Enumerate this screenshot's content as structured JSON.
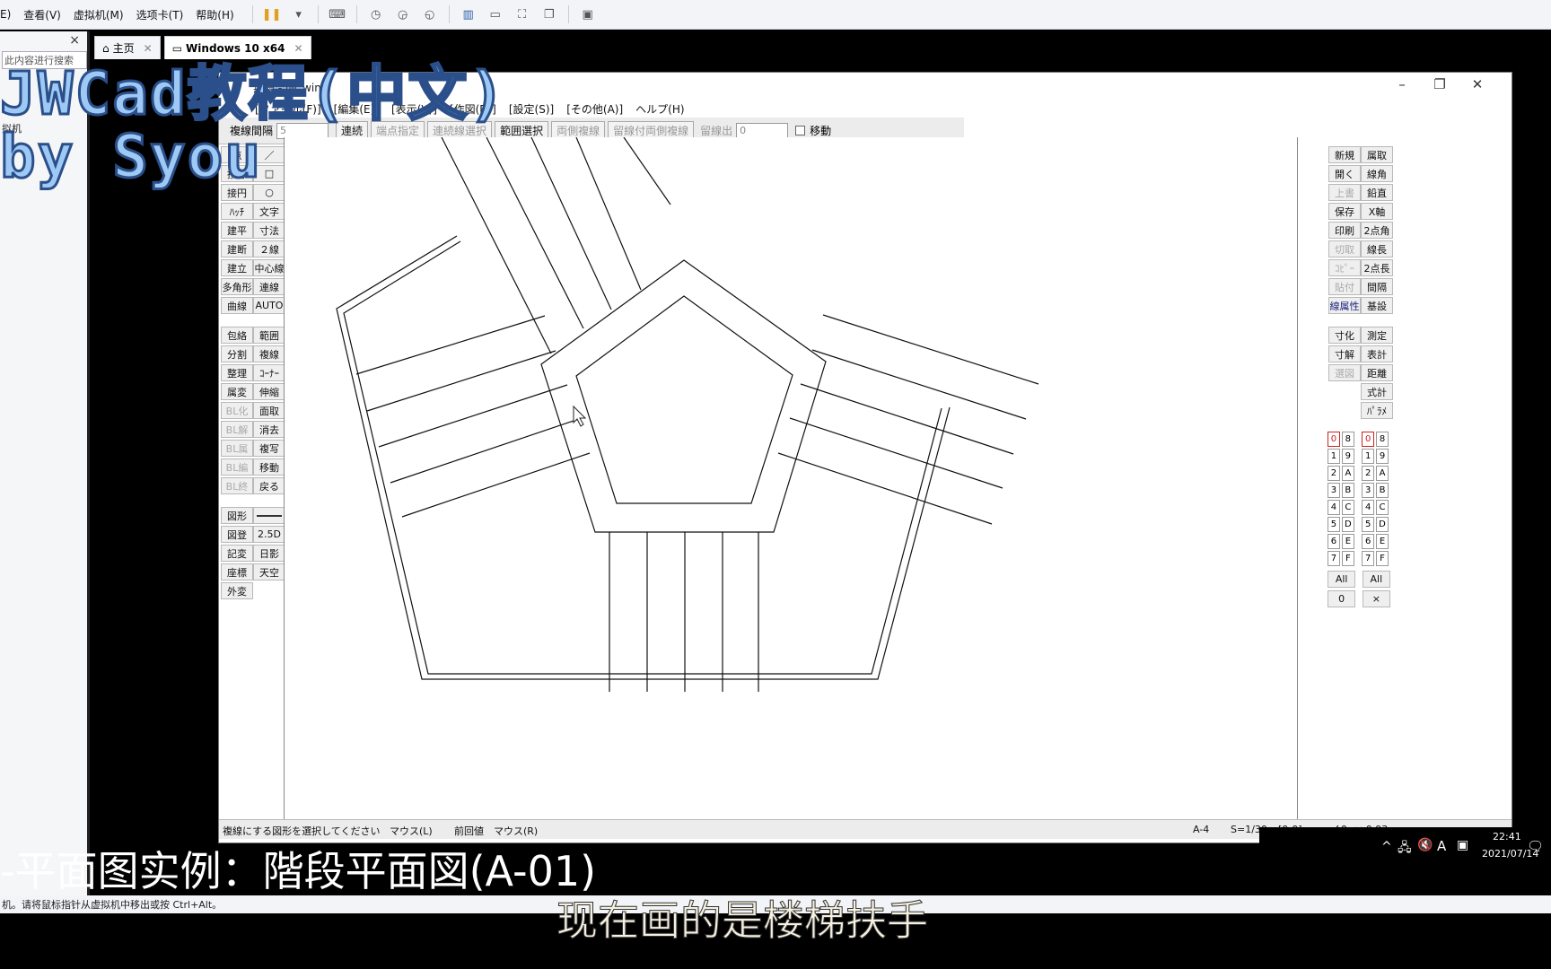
{
  "host": {
    "menus": [
      "E)",
      "查看(V)",
      "虚拟机(M)",
      "选项卡(T)",
      "帮助(H)"
    ],
    "tabs": [
      {
        "label": "主页"
      },
      {
        "label": "Windows 10 x64"
      }
    ],
    "library_close": "×",
    "library_search": "此内容进行搜索",
    "library_item": "拟机",
    "status": "机。请将鼠标指针从虚拟机中移出或按 Ctrl+Alt。"
  },
  "jw": {
    "title": "無題 - jw_win",
    "menus": [
      "[ファイル(F)]",
      "[編集(E)]",
      "[表示(V)]",
      "[作図(D)]",
      "[設定(S)]",
      "[その他(A)]",
      "ヘルプ(H)"
    ],
    "ctrlbar": {
      "label": "複線間隔",
      "value": "5",
      "buttons": [
        "連続",
        "端点指定",
        "連続線選択",
        "範囲選択",
        "両側複線",
        "留線付両側複線",
        "留線出"
      ],
      "dim_buttons": [
        "端点指定",
        "連続線選択",
        "両側複線",
        "留線付両側複線",
        "留線出"
      ],
      "extra_value": "0",
      "move_label": "移動"
    },
    "left_col1": [
      "点",
      "接線",
      "接円",
      "ﾊｯﾁ",
      "建平",
      "建断",
      "建立",
      "多角形",
      "曲線",
      "包絡",
      "分割",
      "整理",
      "属変",
      "BL化",
      "BL解",
      "BL属",
      "BL編",
      "BL終",
      "図形",
      "図登",
      "記変",
      "座標",
      "外変"
    ],
    "left_col2": [
      "／",
      "□",
      "○",
      "文字",
      "寸法",
      "２線",
      "中心線",
      "連線",
      "AUTO",
      "範囲",
      "複線",
      "ｺｰﾅｰ",
      "伸縮",
      "面取",
      "消去",
      "複写",
      "移動",
      "戻る",
      "",
      "2.5D",
      "日影",
      "天空"
    ],
    "right_col1": [
      "新規",
      "開く",
      "上書",
      "保存",
      "印刷",
      "切取",
      "ｺﾋﾟｰ",
      "貼付",
      "線属性",
      "寸化",
      "寸解",
      "選図",
      "",
      "All",
      "0"
    ],
    "right_col2": [
      "属取",
      "線角",
      "鉛直",
      "X軸",
      "2点角",
      "線長",
      "2点長",
      "間隔",
      "基設",
      "測定",
      "表計",
      "距離",
      "式計",
      "ﾊﾟﾗﾒ",
      "All",
      "×"
    ],
    "layers_left": [
      "0",
      "1",
      "2",
      "3",
      "4",
      "5",
      "6",
      "7",
      "8",
      "9",
      "A",
      "B",
      "C",
      "D",
      "E",
      "F"
    ],
    "layers_right": [
      "0",
      "8",
      "1",
      "9",
      "2",
      "A",
      "3",
      "B",
      "4",
      "C",
      "5",
      "D",
      "6",
      "E",
      "7",
      "F"
    ],
    "status": {
      "message": "複線にする図形を選択してください",
      "mouse_l": "マウス(L)",
      "prev": "前回値",
      "mouse_r": "マウス(R)",
      "paper": "A-4",
      "scale": "S=1/30",
      "layer": "[0-0]",
      "angle": "∠0",
      "factor": "× 0.93"
    }
  },
  "taskbar": {
    "ime": "A",
    "time": "22:41",
    "date": "2021/07/14"
  },
  "overlay": {
    "title_line1": "JWCad教程(中文)",
    "title_line2": "by Syou",
    "chapter": "-平面图实例：階段平面図(A-01)",
    "subtitle": "现在画的是楼梯扶手"
  }
}
